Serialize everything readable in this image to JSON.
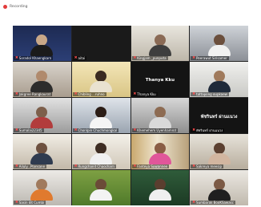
{
  "recording": {
    "label": "Recording"
  },
  "tiles": [
    {
      "name": "Soradol Khaengkarn"
    },
    {
      "name": "aitai"
    },
    {
      "name": "Kingjam _punputa"
    },
    {
      "name": "Peerawut Sirisamer"
    },
    {
      "name": "Jakgree Rangkaurat"
    },
    {
      "name": "Chibling ...ruhno"
    },
    {
      "name": "Thanya Kku",
      "center": "Thanya Kku"
    },
    {
      "name": "tattapong oupkaew"
    },
    {
      "name": "Sumalai22345"
    },
    {
      "name": "Chonlpin Chuchmongkal"
    },
    {
      "name": "Khemehem Uyenhamrot"
    },
    {
      "name": "พัชรินทร์ ผ่านแนวง",
      "center": "พัชรินทร์ ผ่านแนวง"
    },
    {
      "name": "Ailuly...Plansane"
    },
    {
      "name": "Rungchanit Chaocharn"
    },
    {
      "name": "Fanteya Suwannee"
    },
    {
      "name": "Sakreya  meesip"
    },
    {
      "name": "Sasin dit Cumbi"
    },
    {
      "name": ""
    },
    {
      "name": ""
    },
    {
      "name": "Sumbarak BooKSawasc"
    }
  ],
  "colors": {
    "muted_mic": "#ff4d4d",
    "active_speaker": "#e5d34a"
  }
}
